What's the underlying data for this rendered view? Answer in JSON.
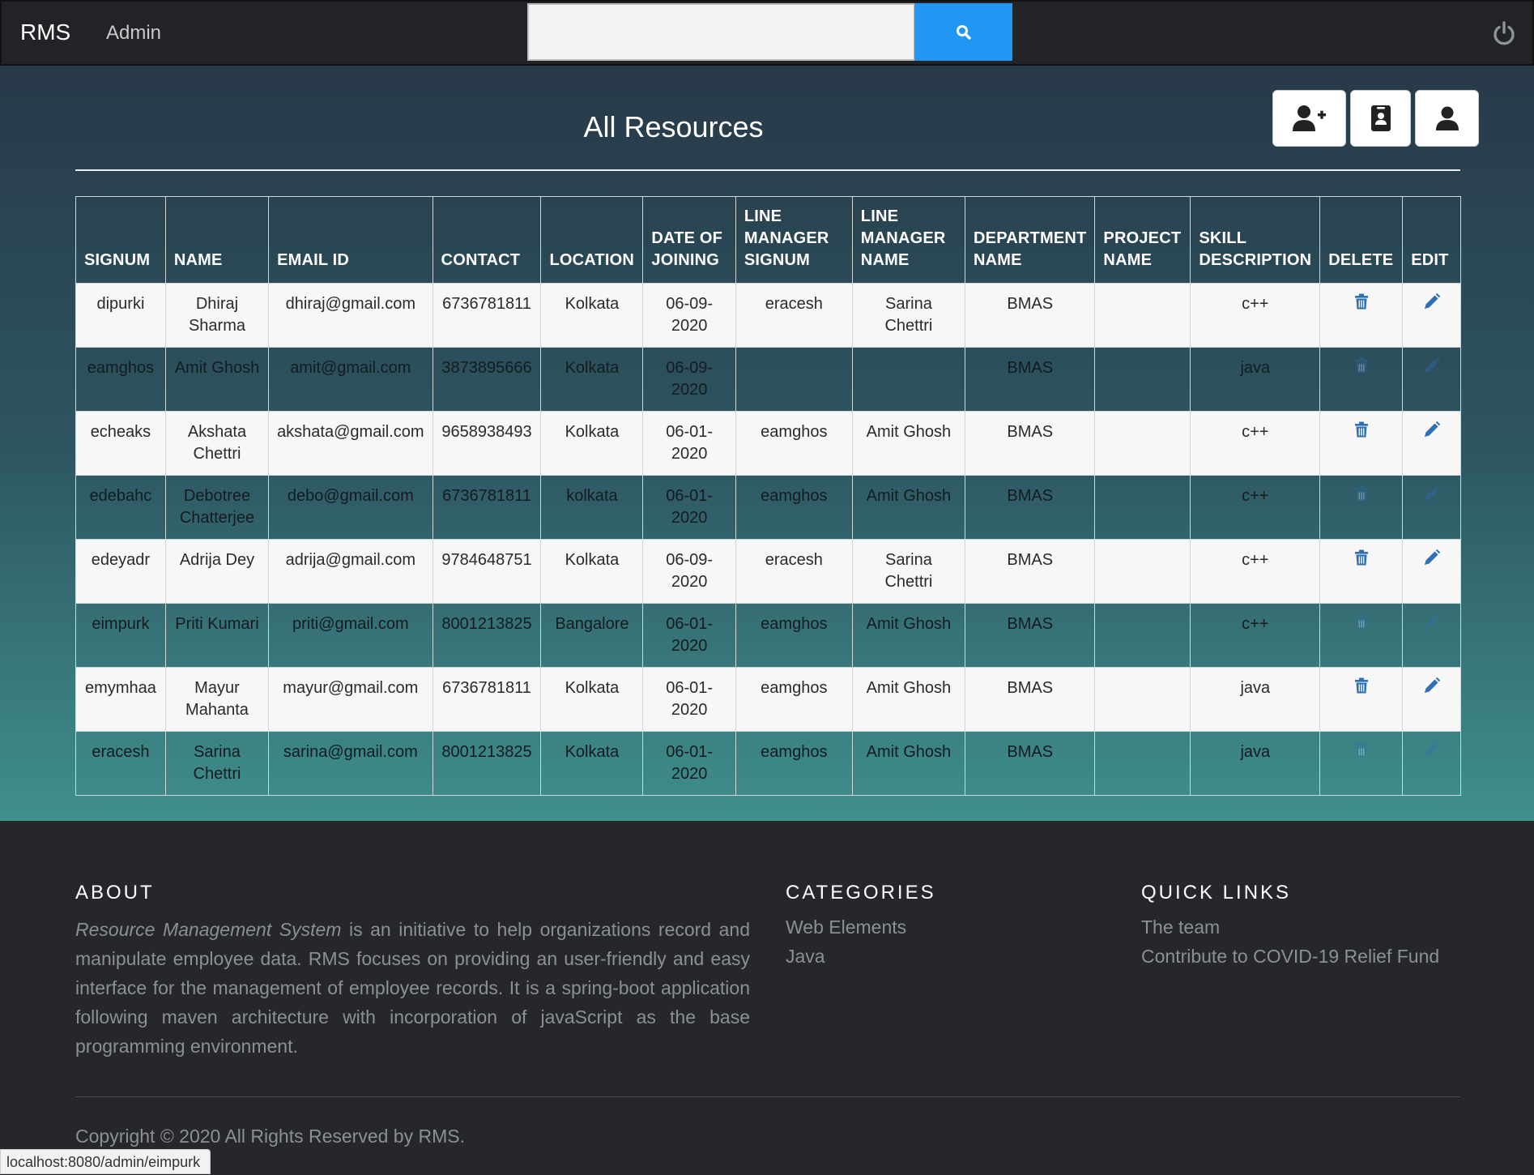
{
  "navbar": {
    "brand": "RMS",
    "admin_label": "Admin",
    "search": {
      "value": "",
      "placeholder": ""
    },
    "search_icon": "search-icon",
    "power_icon": "power-icon"
  },
  "main": {
    "title": "All Resources",
    "actions": [
      {
        "name": "add-user",
        "icon": "user-plus-icon"
      },
      {
        "name": "id-badge",
        "icon": "id-badge-icon"
      },
      {
        "name": "profile",
        "icon": "user-icon"
      }
    ]
  },
  "table": {
    "headers": [
      "SIGNUM",
      "NAME",
      "EMAIL ID",
      "CONTACT",
      "LOCATION",
      "DATE OF JOINING",
      "LINE MANAGER SIGNUM",
      "LINE MANAGER NAME",
      "DEPARTMENT NAME",
      "PROJECT NAME",
      "SKILL DESCRIPTION",
      "DELETE",
      "EDIT"
    ],
    "rows": [
      {
        "signum": "dipurki",
        "name": "Dhiraj Sharma",
        "email": "dhiraj@gmail.com",
        "contact": "6736781811",
        "location": "Kolkata",
        "doj": "06-09-2020",
        "lm_signum": "eracesh",
        "lm_name": "Sarina Chettri",
        "department": "BMAS",
        "project": "",
        "skill": "c++"
      },
      {
        "signum": "eamghos",
        "name": "Amit Ghosh",
        "email": "amit@gmail.com",
        "contact": "3873895666",
        "location": "Kolkata",
        "doj": "06-09-2020",
        "lm_signum": "",
        "lm_name": "",
        "department": "BMAS",
        "project": "",
        "skill": "java"
      },
      {
        "signum": "echeaks",
        "name": "Akshata Chettri",
        "email": "akshata@gmail.com",
        "contact": "9658938493",
        "location": "Kolkata",
        "doj": "06-01-2020",
        "lm_signum": "eamghos",
        "lm_name": "Amit Ghosh",
        "department": "BMAS",
        "project": "",
        "skill": "c++"
      },
      {
        "signum": "edebahc",
        "name": "Debotree Chatterjee",
        "email": "debo@gmail.com",
        "contact": "6736781811",
        "location": "kolkata",
        "doj": "06-01-2020",
        "lm_signum": "eamghos",
        "lm_name": "Amit Ghosh",
        "department": "BMAS",
        "project": "",
        "skill": "c++"
      },
      {
        "signum": "edeyadr",
        "name": "Adrija Dey",
        "email": "adrija@gmail.com",
        "contact": "9784648751",
        "location": "Kolkata",
        "doj": "06-09-2020",
        "lm_signum": "eracesh",
        "lm_name": "Sarina Chettri",
        "department": "BMAS",
        "project": "",
        "skill": "c++"
      },
      {
        "signum": "eimpurk",
        "name": "Priti Kumari",
        "email": "priti@gmail.com",
        "contact": "8001213825",
        "location": "Bangalore",
        "doj": "06-01-2020",
        "lm_signum": "eamghos",
        "lm_name": "Amit Ghosh",
        "department": "BMAS",
        "project": "",
        "skill": "c++"
      },
      {
        "signum": "emymhaa",
        "name": "Mayur Mahanta",
        "email": "mayur@gmail.com",
        "contact": "6736781811",
        "location": "Kolkata",
        "doj": "06-01-2020",
        "lm_signum": "eamghos",
        "lm_name": "Amit Ghosh",
        "department": "BMAS",
        "project": "",
        "skill": "java"
      },
      {
        "signum": "eracesh",
        "name": "Sarina Chettri",
        "email": "sarina@gmail.com",
        "contact": "8001213825",
        "location": "Kolkata",
        "doj": "06-01-2020",
        "lm_signum": "eamghos",
        "lm_name": "Amit Ghosh",
        "department": "BMAS",
        "project": "",
        "skill": "java"
      }
    ],
    "delete_icon": "trash-icon",
    "edit_icon": "pencil-icon"
  },
  "footer": {
    "about": {
      "heading": "ABOUT",
      "italic_lead": "Resource Management System",
      "text": " is an initiative to help organizations record and manipulate employee data. RMS focuses on providing an user-friendly and easy interface for the management of employee records. It is a spring-boot application following maven architecture with incorporation of javaScript as the base programming environment."
    },
    "categories": {
      "heading": "CATEGORIES",
      "links": [
        "Web Elements",
        "Java"
      ]
    },
    "quick_links": {
      "heading": "QUICK LINKS",
      "links": [
        "The team",
        "Contribute to COVID-19 Relief Fund"
      ]
    },
    "copyright": "Copyright © 2020 All Rights Reserved by RMS."
  },
  "status_bar": {
    "url": "localhost:8080/admin/eimpurk"
  },
  "colors": {
    "navbar_bg": "#222326",
    "search_button": "#2196f3",
    "footer_bg": "#25272b",
    "icon_blue": "#2f6fb3"
  }
}
